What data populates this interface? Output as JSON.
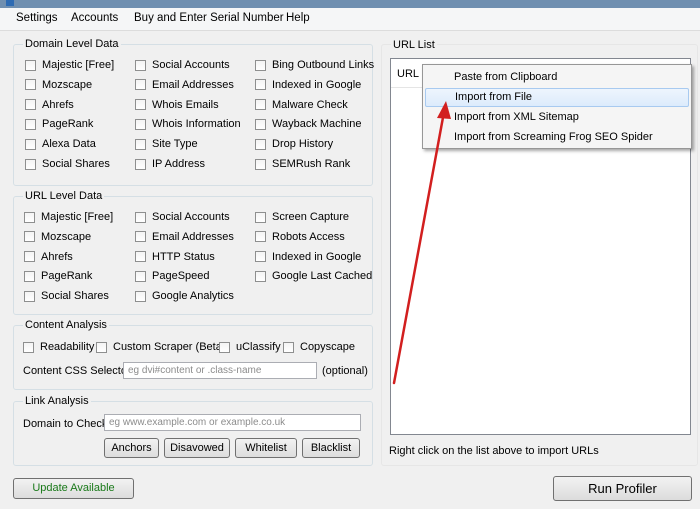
{
  "menu": [
    "Settings",
    "Accounts",
    "Buy and Enter Serial Number",
    "Help"
  ],
  "domain_level": {
    "title": "Domain Level Data",
    "col1": [
      "Majestic [Free]",
      "Mozscape",
      "Ahrefs",
      "PageRank",
      "Alexa Data",
      "Social Shares"
    ],
    "col2": [
      "Social Accounts",
      "Email Addresses",
      "Whois Emails",
      "Whois Information",
      "Site Type",
      "IP Address"
    ],
    "col3": [
      "Bing Outbound Links",
      "Indexed in Google",
      "Malware Check",
      "Wayback Machine",
      "Drop History",
      "SEMRush Rank"
    ]
  },
  "url_level": {
    "title": "URL Level Data",
    "col1": [
      "Majestic [Free]",
      "Mozscape",
      "Ahrefs",
      "PageRank",
      "Social Shares"
    ],
    "col2": [
      "Social Accounts",
      "Email Addresses",
      "HTTP Status",
      "PageSpeed",
      "Google Analytics"
    ],
    "col3": [
      "Screen Capture",
      "Robots Access",
      "Indexed in Google",
      "Google Last Cached"
    ]
  },
  "content_analysis": {
    "title": "Content Analysis",
    "options": [
      "Readability",
      "Custom Scraper (Beta)",
      "uClassify",
      "Copyscape"
    ],
    "css_label": "Content CSS Selector:",
    "css_placeholder": "eg dvi#content or .class-name",
    "optional": "(optional)"
  },
  "link_analysis": {
    "title": "Link Analysis",
    "domain_label": "Domain to Check:",
    "domain_placeholder": "eg www.example.com or example.co.uk",
    "buttons": [
      "Anchors",
      "Disavowed",
      "Whitelist",
      "Blacklist"
    ]
  },
  "url_list": {
    "title": "URL List",
    "column": "URL",
    "hint": "Right click on the list above to import URLs"
  },
  "context_menu": {
    "items": [
      "Paste from Clipboard",
      "Import from File",
      "Import from XML Sitemap",
      "Import from Screaming Frog SEO Spider"
    ],
    "highlighted_index": 1
  },
  "update_button": "Update Available",
  "run_button": "Run Profiler",
  "colors": {
    "update_text": "#1a7a1a",
    "arrow": "#d21f1f",
    "highlight": "#dcebfc"
  }
}
